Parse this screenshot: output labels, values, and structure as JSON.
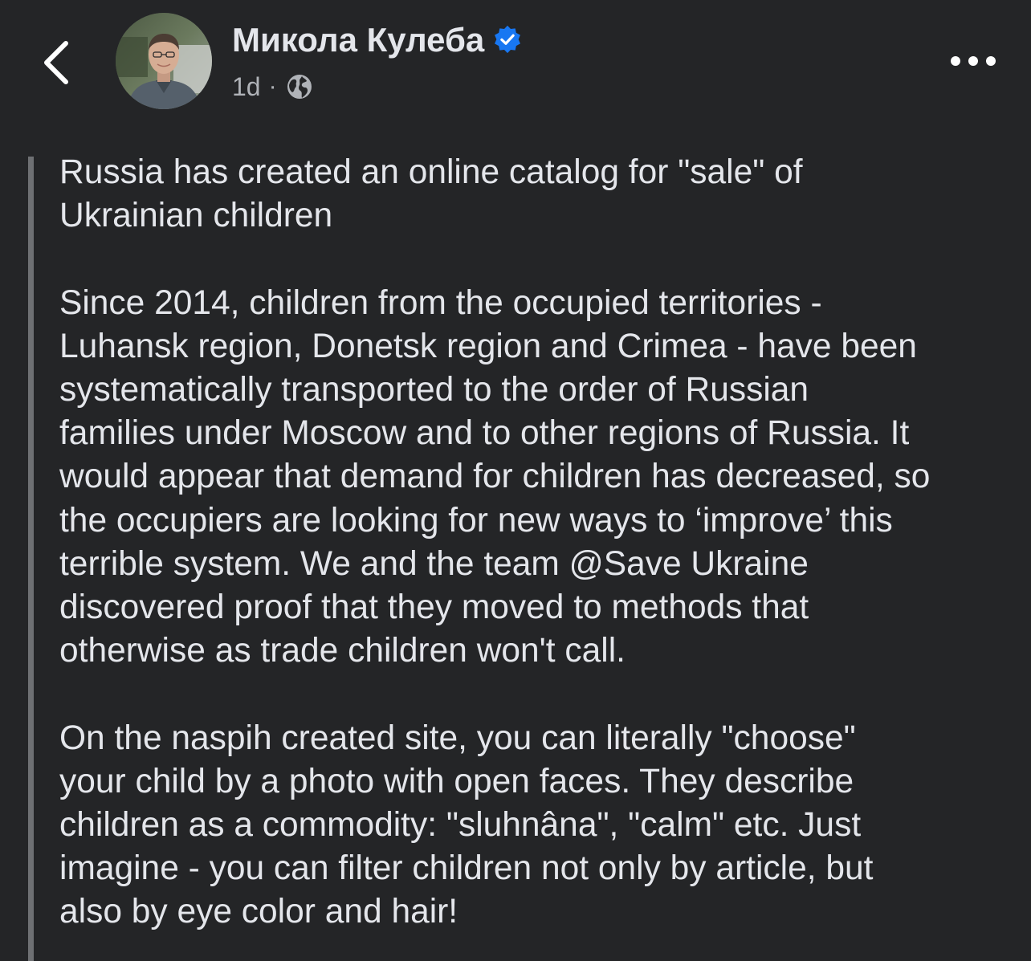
{
  "post": {
    "author": "Микола Кулеба",
    "timestamp": "1d",
    "meta_separator": "·",
    "verified": true,
    "privacy_icon": "globe-icon",
    "paragraphs": [
      [
        "Russia has created an online catalog for \"sale\" of",
        "Ukrainian children"
      ],
      [
        "Since 2014, children from the occupied territories -",
        "Luhansk region, Donetsk region and Crimea - have been",
        "systematically transported to the order of Russian",
        "families under Moscow and to other regions of Russia. It",
        "would appear that demand for children has decreased, so",
        "the occupiers are looking for new ways to ‘improve’ this",
        "terrible system. We and the team @Save Ukraine",
        "discovered proof that they moved to methods that",
        "otherwise as trade children won't call."
      ],
      [
        "On the naspih created site, you can literally \"choose\"",
        "your child by a photo with open faces. They describe",
        "children as a commodity: \"sluhnâna\", \"calm\" etc. Just",
        "imagine - you can filter children not only by article, but",
        "also by eye color and hair!"
      ]
    ]
  },
  "icons": {
    "back": "chevron-left-icon",
    "verified": "verified-badge-icon",
    "more": "more-options-icon"
  },
  "colors": {
    "background": "#242527",
    "text": "#e4e6eb",
    "secondary_text": "#b0b3b8",
    "verified_blue": "#1877f2",
    "quote_bar": "#6e7073"
  }
}
